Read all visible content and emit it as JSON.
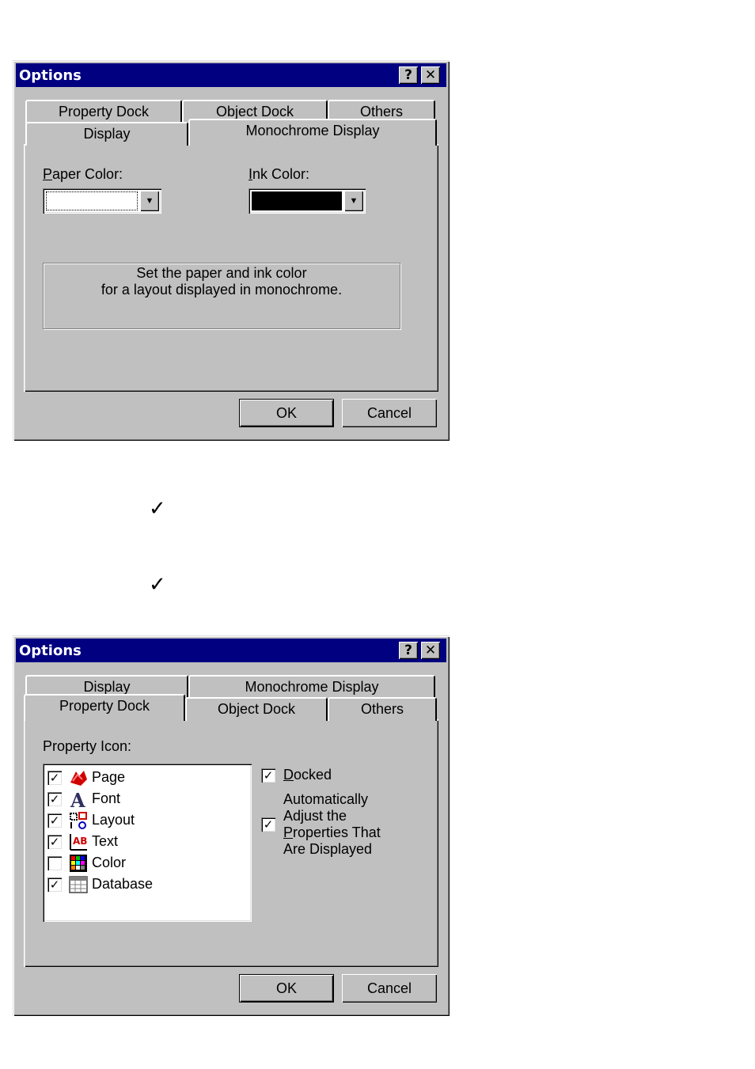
{
  "dialog1": {
    "title": "Options",
    "help_btn": "?",
    "close_btn": "✕",
    "tabs_back": [
      "Property Dock",
      "Object Dock",
      "Others"
    ],
    "tabs_front": [
      "Display",
      "Monochrome Display"
    ],
    "active_tab": "Monochrome Display",
    "paper_color_label": "Paper Color:",
    "ink_color_label": "Ink Color:",
    "paper_color_value": "#ffffff",
    "ink_color_value": "#000000",
    "description_line1": "Set the paper and ink color",
    "description_line2": "for a layout displayed in monochrome.",
    "ok": "OK",
    "cancel": "Cancel"
  },
  "checkmarks": [
    "✓",
    "✓"
  ],
  "dialog2": {
    "title": "Options",
    "help_btn": "?",
    "close_btn": "✕",
    "tabs_back": [
      "Display",
      "Monochrome Display"
    ],
    "tabs_front": [
      "Property Dock",
      "Object Dock",
      "Others"
    ],
    "active_tab": "Property Dock",
    "property_icon_label": "Property Icon:",
    "items": [
      {
        "label": "Page",
        "checked": true,
        "icon": "page-icon"
      },
      {
        "label": "Font",
        "checked": true,
        "icon": "font-icon"
      },
      {
        "label": "Layout",
        "checked": true,
        "icon": "layout-icon"
      },
      {
        "label": "Text",
        "checked": true,
        "icon": "text-icon"
      },
      {
        "label": "Color",
        "checked": false,
        "icon": "color-icon"
      },
      {
        "label": "Database",
        "checked": true,
        "icon": "database-icon"
      }
    ],
    "docked_label": "Docked",
    "docked_checked": true,
    "auto_label_lines": [
      "Automatically",
      "Adjust the",
      "Properties That",
      "Are Displayed"
    ],
    "auto_checked": true,
    "ok": "OK",
    "cancel": "Cancel"
  }
}
